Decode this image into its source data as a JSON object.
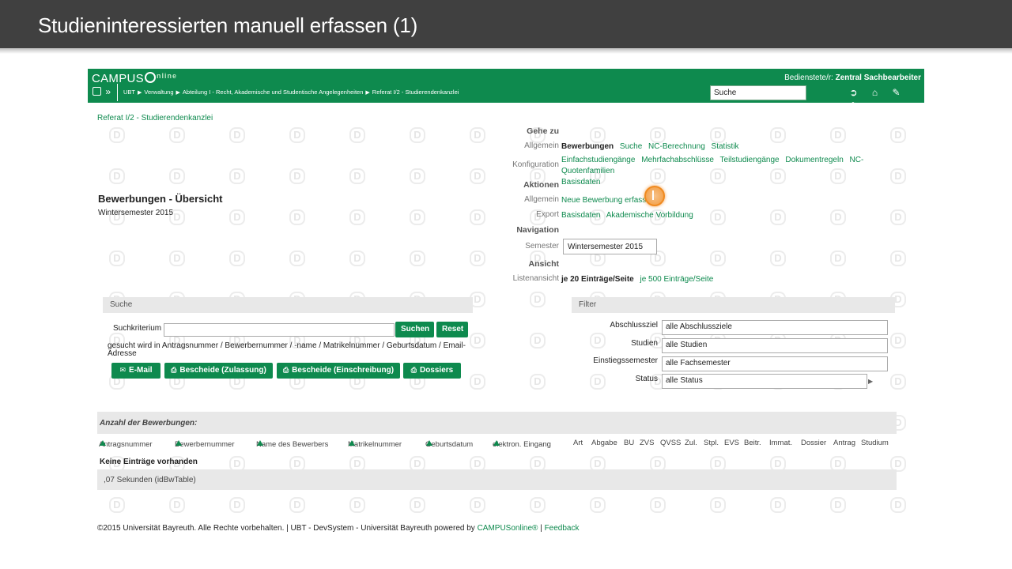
{
  "slide": {
    "title": "Studieninteressierten manuell erfassen (1)"
  },
  "header": {
    "logo_text": "CAMPUS",
    "logo_suffix": "nline",
    "user_prefix": "Bedienstete/r:",
    "user_name": "Zentral Sachbearbeiter",
    "breadcrumbs": [
      "UBT",
      "Verwaltung",
      "Abteilung I - Recht, Akademische und Studentische Angelegenheiten",
      "Referat I/2 - Studierendenkanzlei"
    ],
    "search_value": "Suche",
    "icons": [
      "logout-icon",
      "home-icon",
      "edit-icon",
      "dashboard-icon"
    ]
  },
  "page": {
    "org_link": "Referat I/2 - Studierendenkanzlei",
    "title": "Bewerbungen - Übersicht",
    "subtitle": "Wintersemester 2015"
  },
  "goto": {
    "heading": "Gehe zu",
    "allgemein_label": "Allgemein",
    "allgemein_current": "Bewerbungen",
    "allgemein_links": [
      "Suche",
      "NC-Berechnung",
      "Statistik"
    ],
    "konfiguration_label": "Konfiguration",
    "konfiguration_links": [
      "Einfachstudiengänge",
      "Mehrfachabschlüsse",
      "Teilstudiengänge",
      "Dokumentregeln",
      "NC-Quotenfamilien",
      "Basisdaten"
    ],
    "aktionen_heading": "Aktionen",
    "aktionen_allgemein_label": "Allgemein",
    "neue_bewerbung": "Neue Bewerbung erfassen",
    "export_label": "Export",
    "export_links": [
      "Basisdaten",
      "Akademische Vorbildung"
    ],
    "navigation_heading": "Navigation",
    "semester_label": "Semester",
    "semester_value": "Wintersemester 2015",
    "ansicht_heading": "Ansicht",
    "listenansicht_label": "Listenansicht",
    "listenansicht_current": "je 20 Einträge/Seite",
    "listenansicht_link": "je 500 Einträge/Seite"
  },
  "search_panel": {
    "heading": "Suche",
    "criterion_label": "Suchkriterium",
    "criterion_value": "",
    "search_button": "Suchen",
    "reset_button": "Reset",
    "hint": "gesucht wird in Antragsnummer / Bewerbernummer / -name / Matrikelnummer / Geburtsdatum / Email-Adresse",
    "action_buttons": [
      "E-Mail",
      "Bescheide (Zulassung)",
      "Bescheide (Einschreibung)",
      "Dossiers"
    ]
  },
  "filter_panel": {
    "heading": "Filter",
    "fields": [
      {
        "label": "Abschlussziel",
        "value": "alle Abschlussziele"
      },
      {
        "label": "Studien",
        "value": "alle Studien"
      },
      {
        "label": "Einstiegssemester",
        "value": "alle Fachsemester"
      },
      {
        "label": "Status",
        "value": "alle Status"
      }
    ]
  },
  "table": {
    "heading": "Anzahl der Bewerbungen:",
    "sortable_columns": [
      "Antragsnummer",
      "Bewerbernummer",
      "Name des Bewerbers",
      "Matrikelnummer",
      "Geburtsdatum",
      "elektron. Eingang"
    ],
    "columns": [
      "Art",
      "Abgabe",
      "BU",
      "ZVS",
      "QVSS",
      "Zul.",
      "Stpl.",
      "EVS",
      "Beitr.",
      "Immat.",
      "Dossier",
      "Antrag",
      "Studium"
    ],
    "empty_message": "Keine Einträge vorhanden",
    "timing": ",07 Sekunden (idBwTable)"
  },
  "footer": {
    "text": "©2015 Universität Bayreuth. Alle Rechte vorbehalten. | UBT - DevSystem - Universität Bayreuth powered by",
    "campus_link": "CAMPUSonline®",
    "separator": "|",
    "feedback_link": "Feedback"
  },
  "colors": {
    "slide_bar": "#404040",
    "brand_green": "#0e8a4e",
    "panel_gray": "#e8e8e8",
    "marker_orange": "#f39a3d"
  }
}
